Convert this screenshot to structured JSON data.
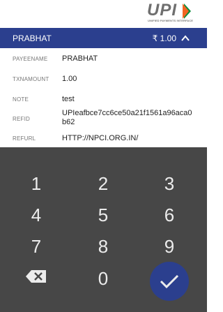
{
  "brand": {
    "logo_text": "UPI",
    "logo_subtitle": "UNIFIED PAYMENTS INTERFACE"
  },
  "header": {
    "payee": "PRABHAT",
    "amount": "₹ 1.00"
  },
  "details": [
    {
      "label": "PAYEENAME",
      "value": "PRABHAT"
    },
    {
      "label": "TXNAMOUNT",
      "value": "1.00"
    },
    {
      "label": "NOTE",
      "value": "test"
    },
    {
      "label": "REFID",
      "value": "UPIeafbce7cc6ce50a21f1561a96aca0b62"
    },
    {
      "label": "REFURL",
      "value": "HTTP://NPCI.ORG.IN/"
    }
  ],
  "keypad": {
    "keys": [
      "1",
      "2",
      "3",
      "4",
      "5",
      "6",
      "7",
      "8",
      "9",
      "0"
    ],
    "backspace_icon": "backspace-icon",
    "submit_icon": "checkmark-icon"
  },
  "colors": {
    "header_bg": "#2b3f8e",
    "keypad_bg": "#474747",
    "submit_bg": "#2b3f8e",
    "logo_orange": "#f26522",
    "logo_green": "#0b8e3c"
  }
}
